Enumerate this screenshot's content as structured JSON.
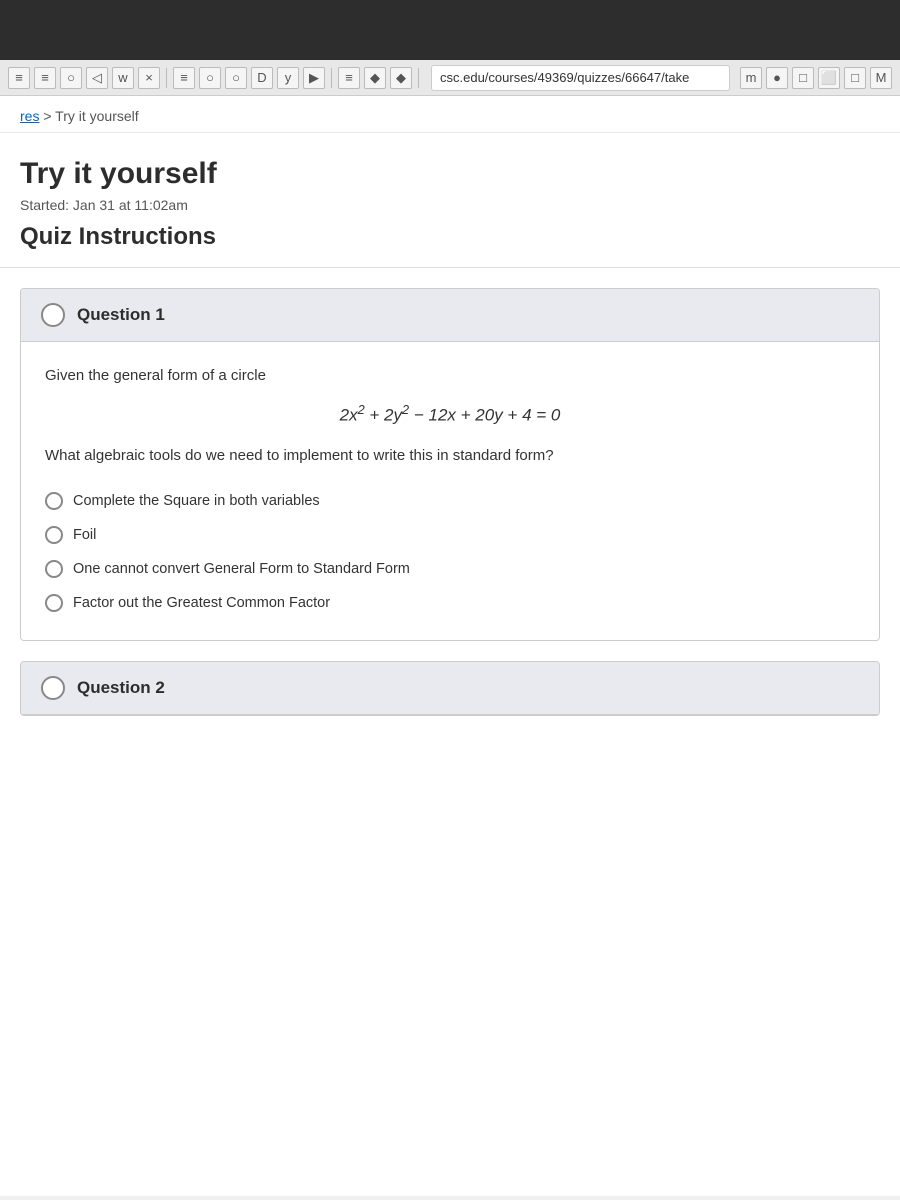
{
  "browser": {
    "address": "csc.edu/courses/49369/quizzes/66647/take",
    "toolbar_icons": [
      "≡",
      "≡",
      "○",
      "◁",
      "w",
      "×",
      "≡",
      "○",
      "○",
      "D",
      "y",
      "▶",
      "≡",
      "◆",
      "◆",
      "m",
      "●",
      "□",
      "⬜",
      "□",
      "M"
    ]
  },
  "breadcrumb": {
    "parts": [
      "res",
      ">",
      "Try it yourself"
    ],
    "link": "res"
  },
  "page": {
    "title": "Try it yourself",
    "started_label": "Started:",
    "started_value": "Jan 31 at 11:02am",
    "instructions_heading": "Quiz Instructions"
  },
  "questions": [
    {
      "number": "Question 1",
      "intro": "Given the general form of a circle",
      "equation": "2x² + 2y² − 12x + 20y + 4 = 0",
      "followup": "What algebraic tools do we need to implement to write this in standard form?",
      "options": [
        "Complete the Square in both variables",
        "Foil",
        "One cannot convert General Form to Standard Form",
        "Factor out the Greatest Common Factor"
      ]
    },
    {
      "number": "Question 2",
      "intro": "",
      "equation": "",
      "followup": "",
      "options": []
    }
  ]
}
